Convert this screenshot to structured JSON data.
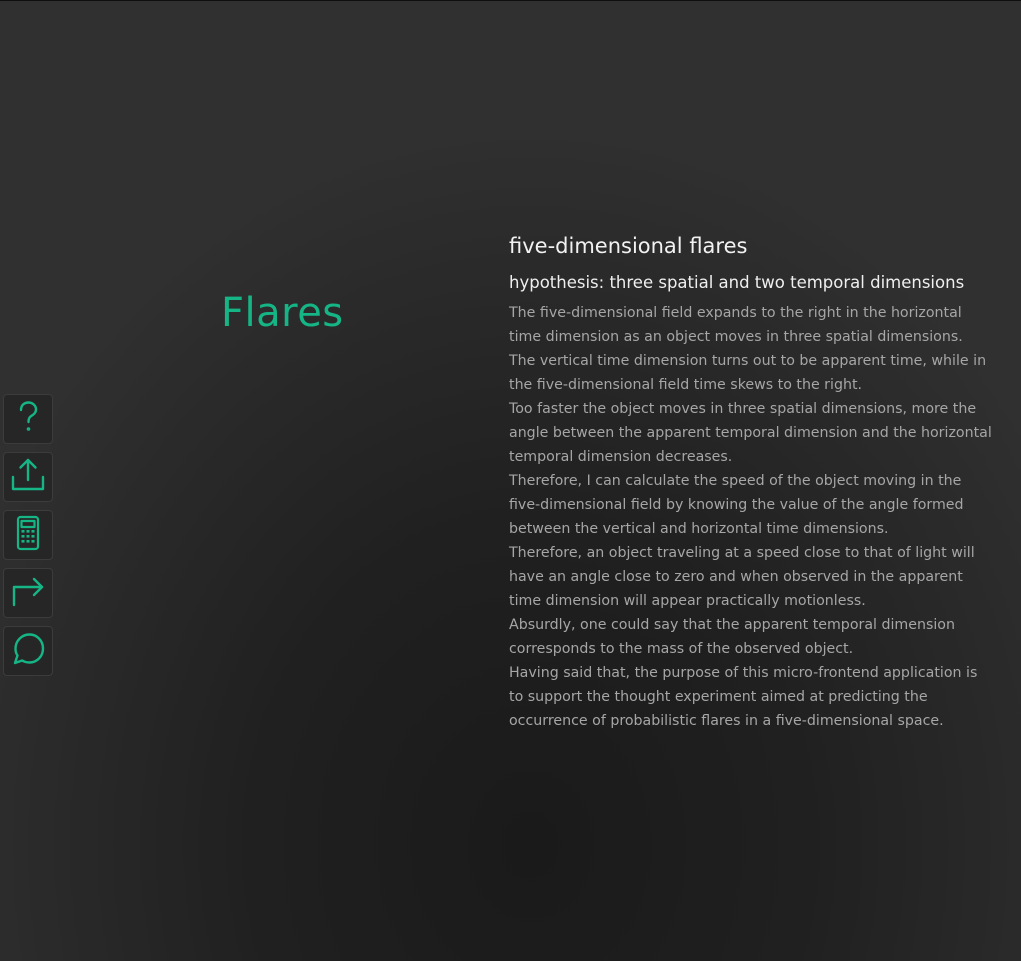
{
  "app": {
    "title": "Flares"
  },
  "toolbar": {
    "buttons": [
      {
        "name": "help-button",
        "icon": "question-mark-icon"
      },
      {
        "name": "upload-button",
        "icon": "upload-icon"
      },
      {
        "name": "calculator-button",
        "icon": "calculator-icon"
      },
      {
        "name": "forward-button",
        "icon": "arrow-turn-right-icon"
      },
      {
        "name": "chat-button",
        "icon": "chat-bubble-icon"
      }
    ]
  },
  "colors": {
    "accent": "#15b585",
    "background": "#232323",
    "heading": "#f2f2f2",
    "body_text": "#a6a6a6"
  },
  "content": {
    "heading": "five-dimensional flares",
    "subheading": "hypothesis: three spatial and two temporal dimensions",
    "paragraphs": [
      "The five-dimensional field expands to the right in the horizontal time dimension as an object moves in three spatial dimensions.",
      "The vertical time dimension turns out to be apparent time, while in the five-dimensional field time skews to the right.",
      "Too faster the object moves in three spatial dimensions, more the angle between the apparent temporal dimension and the horizontal temporal dimension decreases.",
      "Therefore, I can calculate the speed of the object moving in the five-dimensional field by knowing the value of the angle formed between the vertical and horizontal time dimensions.",
      "Therefore, an object traveling at a speed close to that of light will have an angle close to zero and when observed in the apparent time dimension will appear practically motionless.",
      "Absurdly, one could say that the apparent temporal dimension corresponds to the mass of the observed object.",
      "Having said that, the purpose of this micro-frontend application is to support the thought experiment aimed at predicting the occurrence of probabilistic flares in a five-dimensional space."
    ]
  }
}
